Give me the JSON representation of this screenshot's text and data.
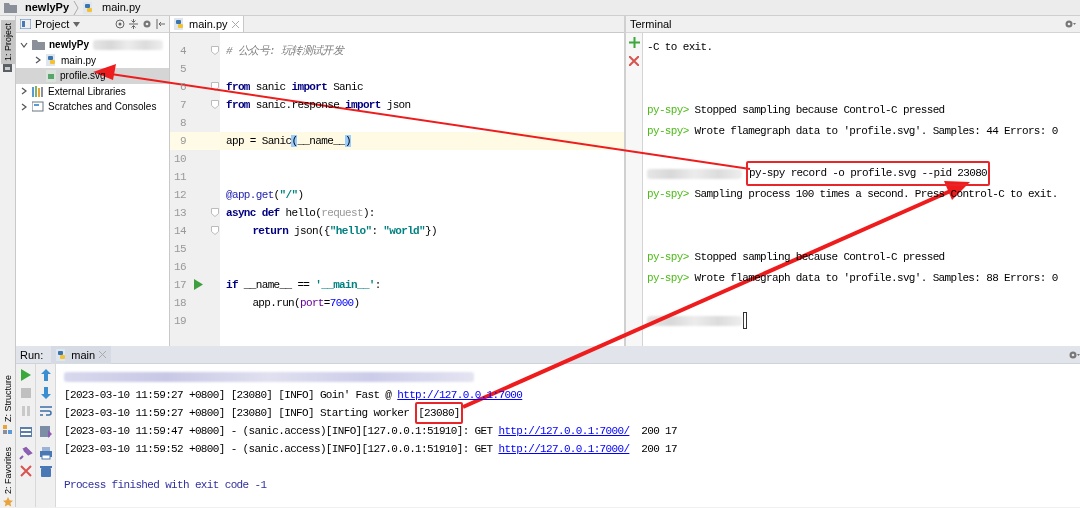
{
  "breadcrumb": [
    {
      "label": "newlyPy",
      "kind": "folder"
    },
    {
      "label": "main.py",
      "kind": "python"
    }
  ],
  "left_strip": [
    {
      "label": "1: Project",
      "selected": true,
      "kind": "project"
    },
    {
      "label": "Z: Structure",
      "selected": false,
      "kind": "structure"
    },
    {
      "label": "2: Favorites",
      "selected": false,
      "kind": "favorites"
    }
  ],
  "project": {
    "title": "Project",
    "tree": [
      {
        "label": "newlyPy",
        "kind": "folder",
        "bold": true,
        "blurred": true,
        "expanded": true,
        "selected": false,
        "children": [
          {
            "label": "main.py",
            "kind": "python",
            "expanded": false,
            "selected": false
          },
          {
            "label": "profile.svg",
            "kind": "svg",
            "selected": true
          }
        ]
      },
      {
        "label": "External Libraries",
        "kind": "library",
        "expanded": false,
        "selected": false
      },
      {
        "label": "Scratches and Consoles",
        "kind": "scratches",
        "expanded": false,
        "selected": false
      }
    ]
  },
  "editor": {
    "tabs": [
      {
        "label": "main.py",
        "selected": true
      }
    ],
    "lines": [
      {
        "number": "4",
        "fold": true,
        "tokens": [
          {
            "text": "# 公众号: 玩转测试开发",
            "kind": "comment"
          }
        ]
      },
      {
        "number": "5"
      },
      {
        "number": "6",
        "fold": true,
        "tokens": [
          {
            "text": "from",
            "kind": "keyword"
          },
          {
            "text": " sanic ",
            "kind": "plain"
          },
          {
            "text": "import",
            "kind": "keyword"
          },
          {
            "text": " Sanic",
            "kind": "plain"
          }
        ]
      },
      {
        "number": "7",
        "fold": true,
        "tokens": [
          {
            "text": "from",
            "kind": "keyword"
          },
          {
            "text": " sanic.response ",
            "kind": "plain"
          },
          {
            "text": "import",
            "kind": "keyword"
          },
          {
            "text": " json",
            "kind": "plain"
          }
        ]
      },
      {
        "number": "8"
      },
      {
        "number": "9",
        "current": true,
        "tokens": [
          {
            "text": "app = Sanic",
            "kind": "plain"
          },
          {
            "text": "(",
            "kind": "brace"
          },
          {
            "text": "__name__",
            "kind": "plain"
          },
          {
            "text": ")",
            "kind": "brace"
          }
        ]
      },
      {
        "number": "10"
      },
      {
        "number": "11"
      },
      {
        "number": "12",
        "tokens": [
          {
            "text": "@app.get",
            "kind": "decorator"
          },
          {
            "text": "(",
            "kind": "plain"
          },
          {
            "text": "\"/\"",
            "kind": "string"
          },
          {
            "text": ")",
            "kind": "plain"
          }
        ]
      },
      {
        "number": "13",
        "fold": true,
        "tokens": [
          {
            "text": "async def",
            "kind": "keyword"
          },
          {
            "text": " hello(",
            "kind": "plain"
          },
          {
            "text": "request",
            "kind": "unused"
          },
          {
            "text": "):",
            "kind": "plain"
          }
        ]
      },
      {
        "number": "14",
        "fold": true,
        "indented": true,
        "tokens": [
          {
            "text": "return",
            "kind": "keyword"
          },
          {
            "text": " json({",
            "kind": "plain"
          },
          {
            "text": "\"hello\"",
            "kind": "string"
          },
          {
            "text": ": ",
            "kind": "plain"
          },
          {
            "text": "\"world\"",
            "kind": "string"
          },
          {
            "text": "})",
            "kind": "plain"
          }
        ]
      },
      {
        "number": "15"
      },
      {
        "number": "16"
      },
      {
        "number": "17",
        "run_marker": true,
        "tokens": [
          {
            "text": "if",
            "kind": "keyword"
          },
          {
            "text": " __name__ == ",
            "kind": "plain"
          },
          {
            "text": "'__main__'",
            "kind": "string"
          },
          {
            "text": ":",
            "kind": "plain"
          }
        ]
      },
      {
        "number": "18",
        "indented": true,
        "tokens": [
          {
            "text": "app.run(",
            "kind": "plain"
          },
          {
            "text": "port",
            "kind": "param"
          },
          {
            "text": "=",
            "kind": "plain"
          },
          {
            "text": "7000",
            "kind": "number"
          },
          {
            "text": ")",
            "kind": "plain"
          }
        ]
      },
      {
        "number": "19"
      }
    ]
  },
  "terminal": {
    "title": "Terminal",
    "lines": [
      {
        "kind": "output",
        "text": "-C to exit."
      },
      {
        "kind": "blank"
      },
      {
        "kind": "blank"
      },
      {
        "kind": "prompt",
        "prompt": "py-spy>",
        "text": " Stopped sampling because Control-C pressed"
      },
      {
        "kind": "prompt",
        "prompt": "py-spy>",
        "text": " Wrote flamegraph data to 'profile.svg'. Samples: 44 Errors: 0"
      },
      {
        "kind": "blank"
      },
      {
        "kind": "command",
        "text": "py-spy record -o profile.svg --pid 23080"
      },
      {
        "kind": "prompt",
        "prompt": "py-spy>",
        "text": " Sampling process 100 times a second. Press Control-C to exit."
      },
      {
        "kind": "blank"
      },
      {
        "kind": "blank"
      },
      {
        "kind": "prompt",
        "prompt": "py-spy>",
        "text": " Stopped sampling because Control-C pressed"
      },
      {
        "kind": "prompt",
        "prompt": "py-spy>",
        "text": " Wrote flamegraph data to 'profile.svg'. Samples: 88 Errors: 0"
      },
      {
        "kind": "blank"
      },
      {
        "kind": "cursor"
      }
    ]
  },
  "run": {
    "label": "Run:",
    "tabs": [
      {
        "label": "main",
        "selected": true
      }
    ],
    "toolbar": [
      {
        "kind": "rerun",
        "disabled": false
      },
      {
        "kind": "stop",
        "disabled": true
      },
      {
        "kind": "pause",
        "disabled": true
      },
      {
        "kind": "layout",
        "disabled": false
      },
      {
        "kind": "pin",
        "disabled": false
      },
      {
        "kind": "close",
        "disabled": false
      }
    ],
    "toolbar2": [
      {
        "kind": "up",
        "disabled": false
      },
      {
        "kind": "down",
        "disabled": false
      },
      {
        "kind": "wrap",
        "disabled": false
      },
      {
        "kind": "scroll-end",
        "disabled": false
      },
      {
        "kind": "print",
        "disabled": false
      },
      {
        "kind": "trash",
        "disabled": false
      }
    ],
    "lines": [
      {
        "kind": "blurred"
      },
      {
        "kind": "log",
        "segments": [
          {
            "text": "[2023-03-10 11:59:27 +0800] [23080] [INFO] Goin' Fast @ ",
            "kind": "plain"
          },
          {
            "text": "http://127.0.0.1:7000",
            "kind": "link"
          }
        ]
      },
      {
        "kind": "log",
        "segments": [
          {
            "text": "[2023-03-10 11:59:27 +0800] [23080] [INFO] Starting worker ",
            "kind": "plain"
          },
          {
            "text": "[23080]",
            "kind": "highlighted"
          }
        ]
      },
      {
        "kind": "log",
        "segments": [
          {
            "text": "[2023-03-10 11:59:47 +0800] - (sanic.access)[INFO][127.0.0.1:51910]: GET ",
            "kind": "plain"
          },
          {
            "text": "http://127.0.0.1:7000/",
            "kind": "link"
          },
          {
            "text": "  200 17",
            "kind": "plain"
          }
        ]
      },
      {
        "kind": "log",
        "segments": [
          {
            "text": "[2023-03-10 11:59:52 +0800] - (sanic.access)[INFO][127.0.0.1:51910]: GET ",
            "kind": "plain"
          },
          {
            "text": "http://127.0.0.1:7000/",
            "kind": "link"
          },
          {
            "text": "  200 17",
            "kind": "plain"
          }
        ]
      },
      {
        "kind": "blank"
      },
      {
        "kind": "exit",
        "text": "Process finished with exit code -1"
      }
    ]
  }
}
